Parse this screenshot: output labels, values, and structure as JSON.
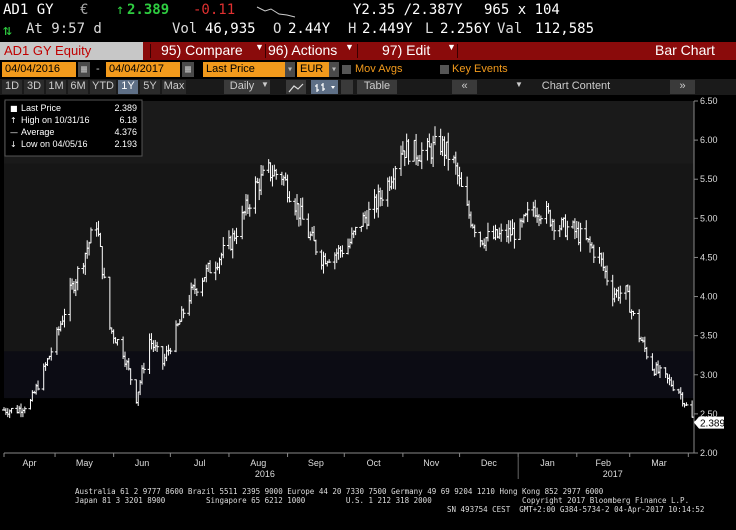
{
  "quote": {
    "ticker": "AD1 GY",
    "currency_symbol": "€",
    "arrow": "↑",
    "last": "2.389",
    "change": "-0.11",
    "bid_ask": "Y2.35 /2.387Y",
    "size": "965 x 104",
    "at_time": "At 9:57 d",
    "vol_label": "Vol",
    "vol": "46,935",
    "open_label": "O",
    "open": "2.44Y",
    "high_label": "H",
    "high": "2.449Y",
    "low_label": "L",
    "low": "2.256Y",
    "val_label": "Val",
    "val": "112,585"
  },
  "function_bar": {
    "security": "AD1 GY Equity",
    "compare": "95) Compare",
    "actions": "96) Actions",
    "edit": "97) Edit",
    "title": "Bar Chart"
  },
  "controls": {
    "start_date": "04/04/2016",
    "end_date": "04/04/2017",
    "field": "Last Price",
    "currency": "EUR",
    "mov_avgs": "Mov Avgs",
    "key_events": "Key Events"
  },
  "periods": [
    "1D",
    "3D",
    "1M",
    "6M",
    "YTD",
    "1Y",
    "5Y",
    "Max"
  ],
  "selected_period": "1Y",
  "frequency": "Daily",
  "table_btn": "Table",
  "chart_content_btn": "Chart Content",
  "colors": {
    "accent": "#f29a1c",
    "function_bar": "#8a0b0b",
    "selected": "#5e6f86",
    "bars": "#ffffff",
    "quote_up": "#2ecc40",
    "quote_down": "#e03030"
  },
  "chart_data": {
    "type": "bar",
    "subtype": "ohlc",
    "legend": [
      {
        "label": "Last Price",
        "value": "2.389"
      },
      {
        "label": "High on 10/31/16",
        "value": "6.18"
      },
      {
        "label": "Average",
        "value": "4.376"
      },
      {
        "label": "Low on 04/05/16",
        "value": "2.193"
      }
    ],
    "legend_placement": "top-left",
    "last_label": "2.389",
    "ylim": [
      2.0,
      6.5
    ],
    "yticks": [
      "2.00",
      "2.50",
      "3.00",
      "3.50",
      "4.00",
      "4.50",
      "5.00",
      "5.50",
      "6.00",
      "6.50"
    ],
    "xticks": [
      "Apr",
      "May",
      "Jun",
      "Jul",
      "Aug",
      "Sep",
      "Oct",
      "Nov",
      "Dec",
      "Jan",
      "Feb",
      "Mar"
    ],
    "year_labels": [
      "2016",
      "2017"
    ],
    "x_range": [
      "2016-04-04",
      "2017-04-04"
    ],
    "series": [
      {
        "close": [
          [
            "2016-04-04",
            2.55
          ],
          [
            "2016-04-11",
            2.55
          ],
          [
            "2016-04-18",
            2.65
          ],
          [
            "2016-04-25",
            3.05
          ],
          [
            "2016-05-02",
            3.5
          ],
          [
            "2016-05-09",
            4.05
          ],
          [
            "2016-05-16",
            4.5
          ],
          [
            "2016-05-23",
            4.95
          ],
          [
            "2016-05-30",
            3.6
          ],
          [
            "2016-06-06",
            3.3
          ],
          [
            "2016-06-13",
            2.7
          ],
          [
            "2016-06-20",
            3.45
          ],
          [
            "2016-06-27",
            3.15
          ],
          [
            "2016-07-04",
            3.55
          ],
          [
            "2016-07-11",
            4.0
          ],
          [
            "2016-07-18",
            4.25
          ],
          [
            "2016-07-25",
            4.45
          ],
          [
            "2016-08-01",
            4.65
          ],
          [
            "2016-08-08",
            5.0
          ],
          [
            "2016-08-15",
            5.4
          ],
          [
            "2016-08-22",
            5.6
          ],
          [
            "2016-08-29",
            5.55
          ],
          [
            "2016-09-05",
            5.2
          ],
          [
            "2016-09-12",
            4.8
          ],
          [
            "2016-09-19",
            4.5
          ],
          [
            "2016-09-26",
            4.55
          ],
          [
            "2016-10-03",
            4.65
          ],
          [
            "2016-10-10",
            4.95
          ],
          [
            "2016-10-17",
            5.15
          ],
          [
            "2016-10-24",
            5.45
          ],
          [
            "2016-10-31",
            5.9
          ],
          [
            "2016-11-07",
            5.85
          ],
          [
            "2016-11-14",
            5.85
          ],
          [
            "2016-11-21",
            5.95
          ],
          [
            "2016-11-28",
            5.7
          ],
          [
            "2016-12-05",
            5.1
          ],
          [
            "2016-12-12",
            4.75
          ],
          [
            "2016-12-19",
            4.75
          ],
          [
            "2016-12-26",
            4.8
          ],
          [
            "2017-01-02",
            4.85
          ],
          [
            "2017-01-09",
            5.15
          ],
          [
            "2017-01-16",
            5.05
          ],
          [
            "2017-01-23",
            4.9
          ],
          [
            "2017-01-30",
            4.85
          ],
          [
            "2017-02-06",
            4.7
          ],
          [
            "2017-02-13",
            4.5
          ],
          [
            "2017-02-20",
            4.05
          ],
          [
            "2017-02-27",
            4.05
          ],
          [
            "2017-03-06",
            3.5
          ],
          [
            "2017-03-13",
            3.1
          ],
          [
            "2017-03-20",
            2.95
          ],
          [
            "2017-03-27",
            2.8
          ],
          [
            "2017-04-04",
            2.389
          ]
        ]
      }
    ]
  },
  "footer": {
    "line1": "Australia 61 2 9777 8600 Brazil 5511 2395 9000 Europe 44 20 7330 7500 Germany 49 69 9204 1210 Hong Kong 852 2977 6000",
    "line2": "Japan 81 3 3201 8900         Singapore 65 6212 1000         U.S. 1 212 318 2000                    Copyright 2017 Bloomberg Finance L.P.",
    "line3": "SN 493754 CEST  GMT+2:00 G384-5734-2 04-Apr-2017 10:14:52"
  }
}
